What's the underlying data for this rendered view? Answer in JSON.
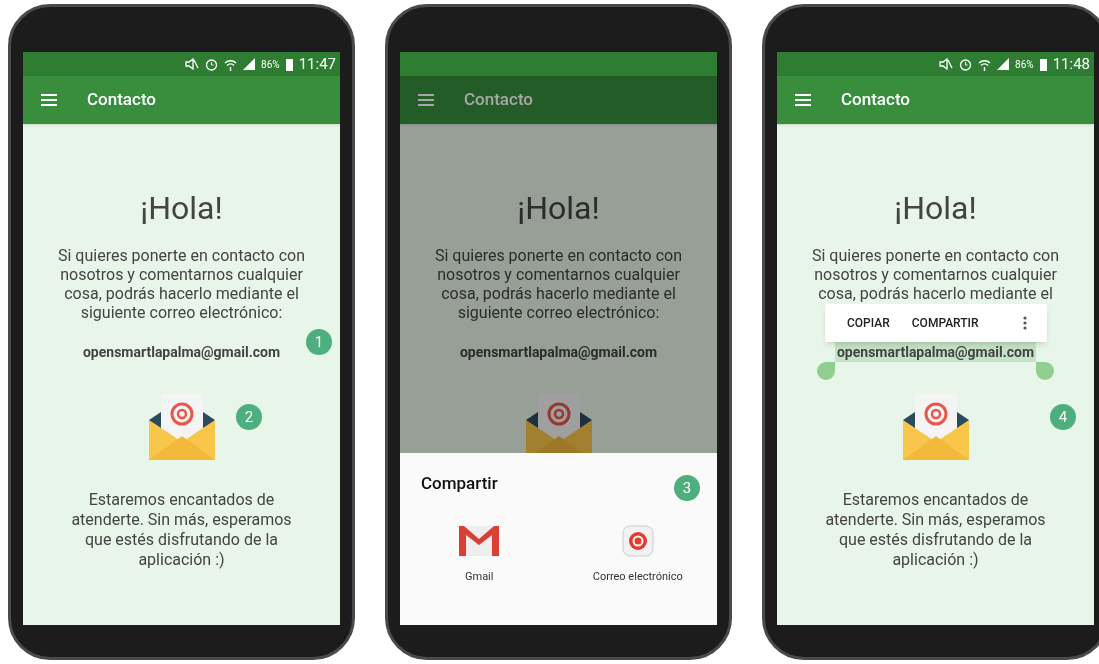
{
  "phones": [
    {
      "status_bar": {
        "battery": "86%",
        "time": "11:47"
      },
      "title": "Contacto",
      "dimmed": false,
      "heading": "¡Hola!",
      "intro": "Si quieres ponerte en contacto con nosotros y comentarnos cualquier cosa, podrás hacerlo mediante el siguiente correo electrónico:",
      "email": "opensmartlapalma@gmail.com",
      "email_selected": false,
      "closing": "Estaremos encantados de atenderte. Sin más, esperamos que estés disfrutando de la aplicación :)",
      "badges": [
        {
          "label": "1",
          "kind": "intro"
        },
        {
          "label": "2",
          "kind": "envelope"
        }
      ]
    },
    {
      "title": "Contacto",
      "dimmed": true,
      "heading": "¡Hola!",
      "intro": "Si quieres ponerte en contacto con nosotros y comentarnos cualquier cosa, podrás hacerlo mediante el siguiente correo electrónico:",
      "email": "opensmartlapalma@gmail.com",
      "email_selected": false,
      "share_sheet": {
        "title": "Compartir",
        "badge": "3",
        "apps": [
          {
            "kind": "gmail",
            "label": "Gmail"
          },
          {
            "kind": "mail",
            "label": "Correo electrónico"
          }
        ]
      }
    },
    {
      "status_bar": {
        "battery": "86%",
        "time": "11:48"
      },
      "title": "Contacto",
      "dimmed": false,
      "heading": "¡Hola!",
      "intro": "Si quieres ponerte en contacto con nosotros y comentarnos cualquier cosa, podrás hacerlo mediante el",
      "email": "opensmartlapalma@gmail.com",
      "email_selected": true,
      "selection_menu": [
        "COPIAR",
        "COMPARTIR"
      ],
      "closing": "Estaremos encantados de atenderte. Sin más, esperamos que estés disfrutando de la aplicación :)",
      "badges": [
        {
          "label": "4",
          "kind": "envelope"
        }
      ]
    }
  ]
}
